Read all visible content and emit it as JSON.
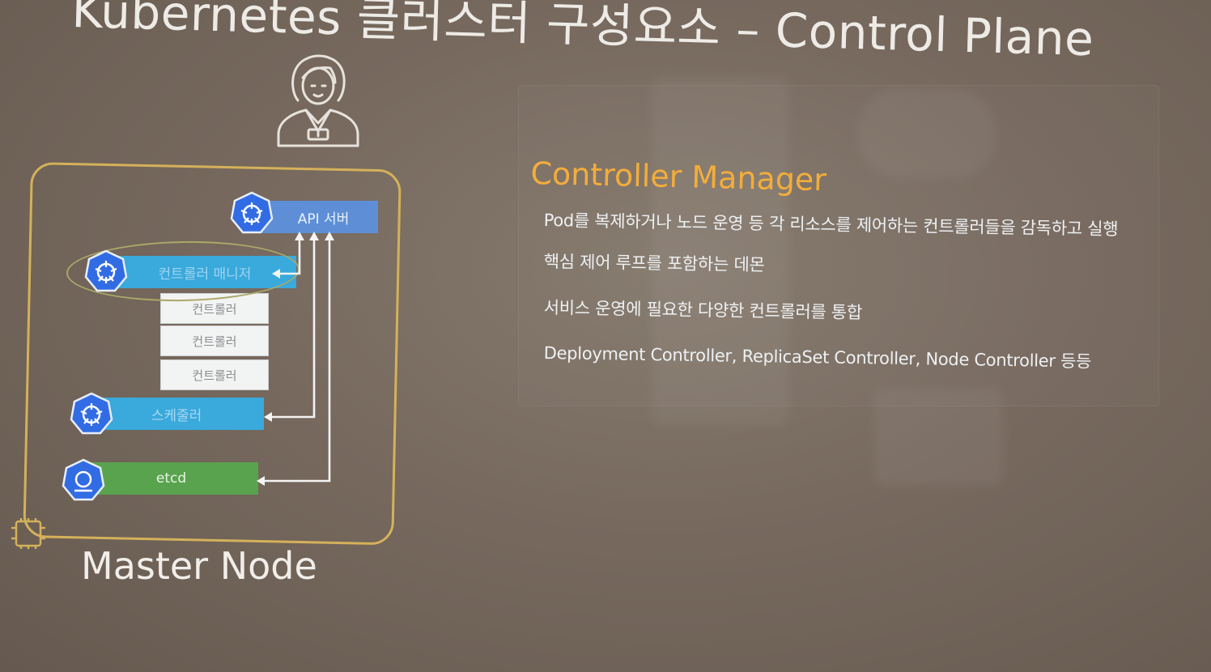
{
  "slide": {
    "title": "Kubernetes 클러스터 구성요소 – Control Plane",
    "master_node_label": "Master Node"
  },
  "diagram": {
    "api_server": "API 서버",
    "controller_manager": "컨트롤러 매니저",
    "controllers": [
      "컨트롤러",
      "컨트롤러",
      "컨트롤러"
    ],
    "scheduler": "스케줄러",
    "etcd": "etcd"
  },
  "content": {
    "heading": "Controller Manager",
    "bullets": [
      "Pod를 복제하거나 노드 운영 등 각 리소스를 제어하는 컨트롤러들을 감독하고 실행",
      "핵심 제어 루프를 포함하는 데몬",
      "서비스 운영에 필요한 다양한 컨트롤러를 통합",
      "Deployment Controller, ReplicaSet Controller, Node Controller 등등"
    ]
  },
  "colors": {
    "background": "#7a6d61",
    "heading": "#f3ad3b",
    "frame": "#d4b15a",
    "api_server": "#5e8fd6",
    "component": "#3aa9dc",
    "etcd": "#5aa34e",
    "k8s_badge": "#326ce5"
  },
  "icons": [
    "user-icon",
    "k8s-logo-icon",
    "chip-icon",
    "arrow-icon"
  ]
}
